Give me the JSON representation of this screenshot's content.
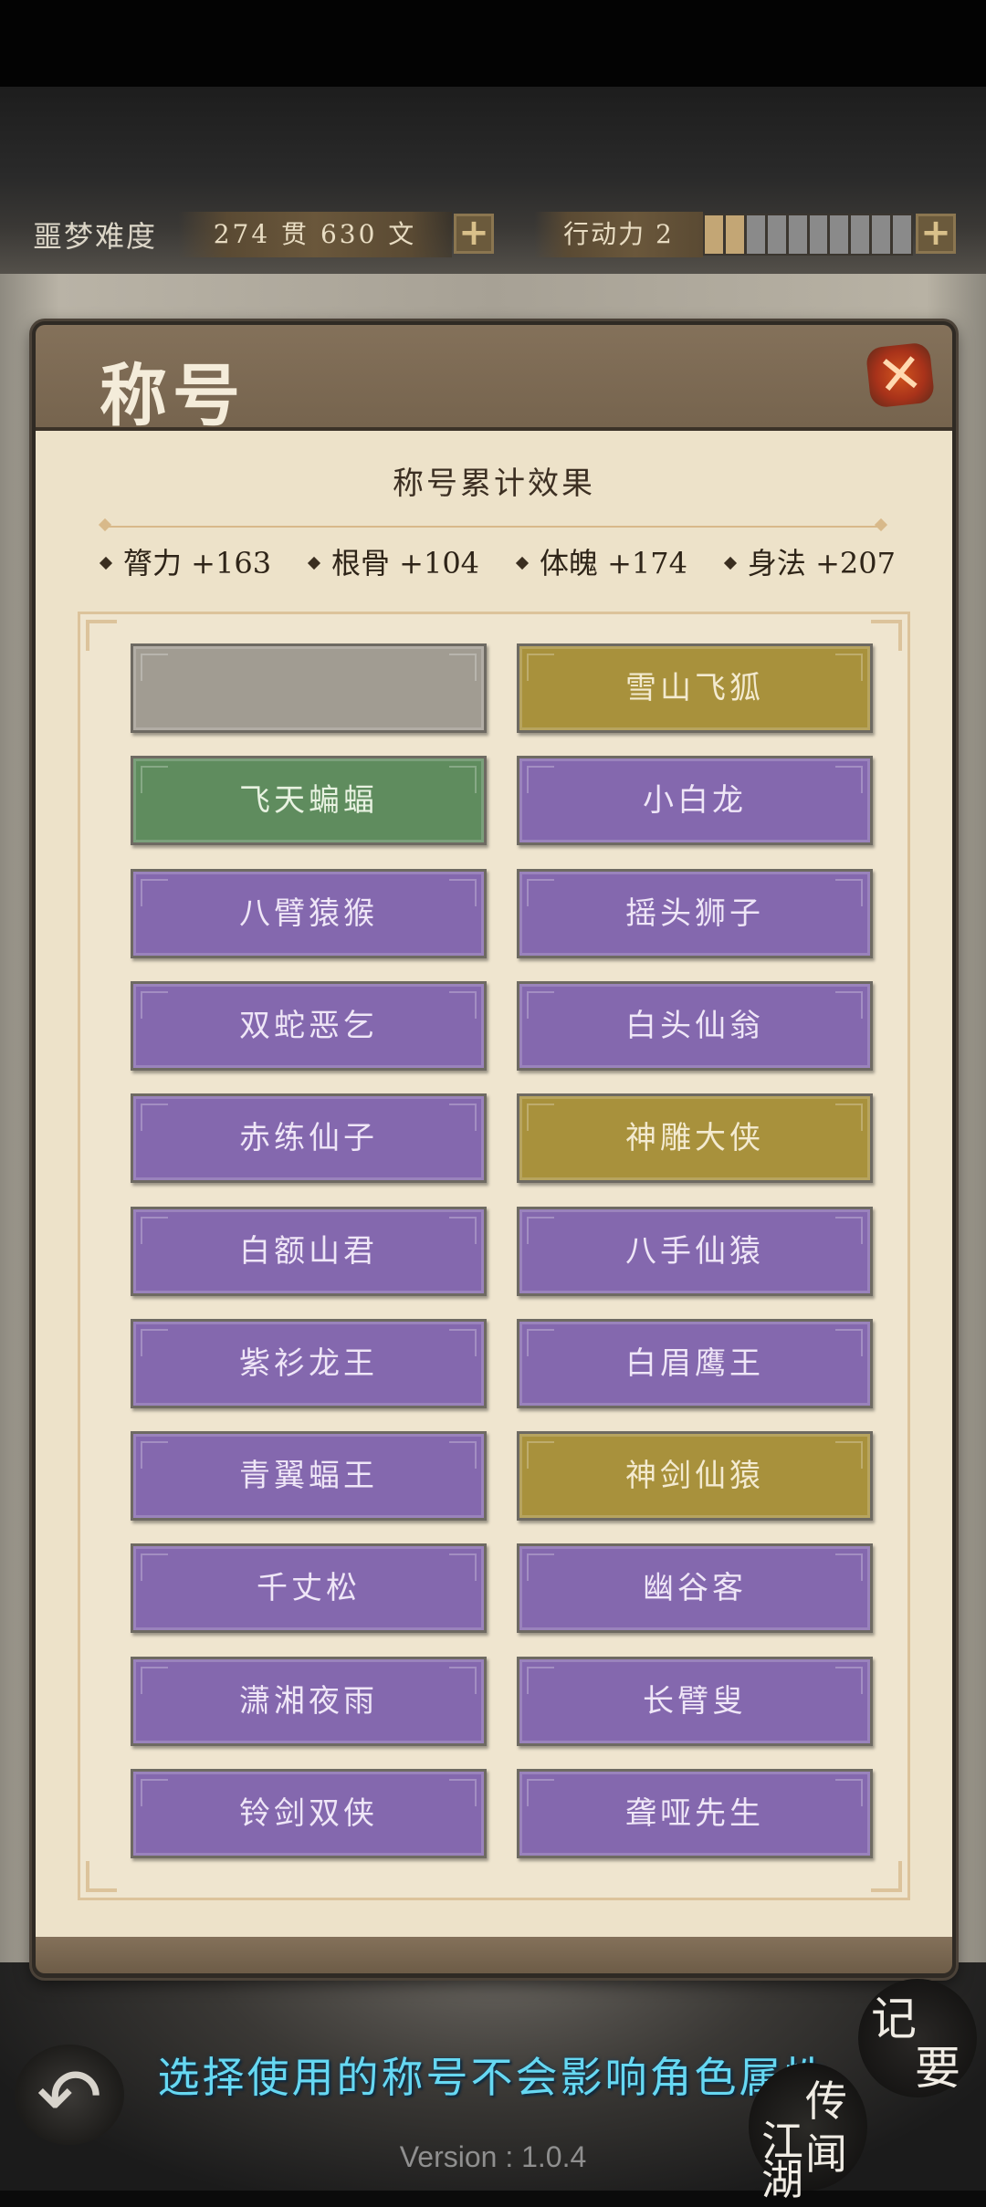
{
  "hud": {
    "difficulty": "噩梦难度",
    "money": "274 贯 630 文",
    "stamina_label": "行动力 2",
    "stamina_current": 2,
    "stamina_max": 10,
    "plus": "+"
  },
  "panel": {
    "title": "称号",
    "close": "✕",
    "summary_title": "称号累计效果",
    "stats": [
      {
        "label": "膂力 +163"
      },
      {
        "label": "根骨 +104"
      },
      {
        "label": "体魄 +174"
      },
      {
        "label": "身法 +207"
      }
    ],
    "titles": [
      {
        "label": "",
        "color": "grey"
      },
      {
        "label": "雪山飞狐",
        "color": "gold"
      },
      {
        "label": "飞天蝙蝠",
        "color": "green"
      },
      {
        "label": "小白龙",
        "color": "purple"
      },
      {
        "label": "八臂猿猴",
        "color": "purple"
      },
      {
        "label": "摇头狮子",
        "color": "purple"
      },
      {
        "label": "双蛇恶乞",
        "color": "purple"
      },
      {
        "label": "白头仙翁",
        "color": "purple"
      },
      {
        "label": "赤练仙子",
        "color": "purple"
      },
      {
        "label": "神雕大侠",
        "color": "gold"
      },
      {
        "label": "白额山君",
        "color": "purple"
      },
      {
        "label": "八手仙猿",
        "color": "purple"
      },
      {
        "label": "紫衫龙王",
        "color": "purple"
      },
      {
        "label": "白眉鹰王",
        "color": "purple"
      },
      {
        "label": "青翼蝠王",
        "color": "purple"
      },
      {
        "label": "神剑仙猿",
        "color": "gold"
      },
      {
        "label": "千丈松",
        "color": "purple"
      },
      {
        "label": "幽谷客",
        "color": "purple"
      },
      {
        "label": "潇湘夜雨",
        "color": "purple"
      },
      {
        "label": "长臂叟",
        "color": "purple"
      },
      {
        "label": "铃剑双侠",
        "color": "purple"
      },
      {
        "label": "聋哑先生",
        "color": "purple"
      },
      {
        "label": "",
        "color": "purple"
      },
      {
        "label": "",
        "color": "purple"
      }
    ]
  },
  "bottom": {
    "back": "↶",
    "notice": "选择使用的称号不会影响角色属性",
    "memo_1": "记",
    "memo_2": "要",
    "legend_1": "传",
    "legend_2": "江",
    "legend_3": "闻",
    "legend_4": "湖",
    "version": "Version : 1.0.4"
  },
  "colors": {
    "purple": "#8468ae",
    "gold": "#a8913c",
    "green": "#5f8c5e",
    "grey": "#a19c92",
    "notice": "#66d8f2"
  }
}
